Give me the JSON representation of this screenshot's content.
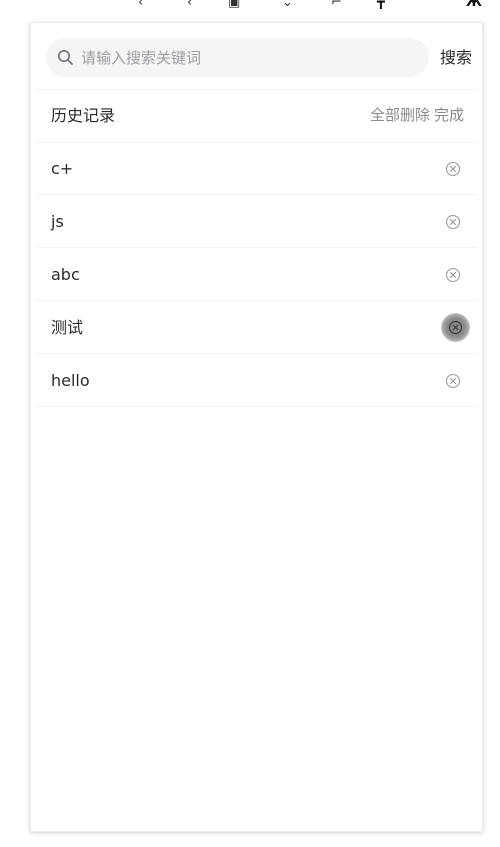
{
  "search": {
    "placeholder": "请输入搜索关键词",
    "value": "",
    "button_label": "搜索"
  },
  "history": {
    "title": "历史记录",
    "delete_all_label": "全部删除",
    "done_label": "完成",
    "items": [
      {
        "label": "c+",
        "delete_icon": "close-circle-icon"
      },
      {
        "label": "js",
        "delete_icon": "close-circle-icon"
      },
      {
        "label": "abc",
        "delete_icon": "close-circle-icon"
      },
      {
        "label": "测试",
        "delete_icon": "close-circle-icon",
        "pressed": true
      },
      {
        "label": "hello",
        "delete_icon": "close-circle-icon"
      }
    ]
  },
  "colors": {
    "text": "#2b2b2b",
    "muted": "#8a8a8a",
    "placeholder": "#9b9ea3",
    "search_bg": "#f4f5f6",
    "divider": "#f3f3f3"
  }
}
